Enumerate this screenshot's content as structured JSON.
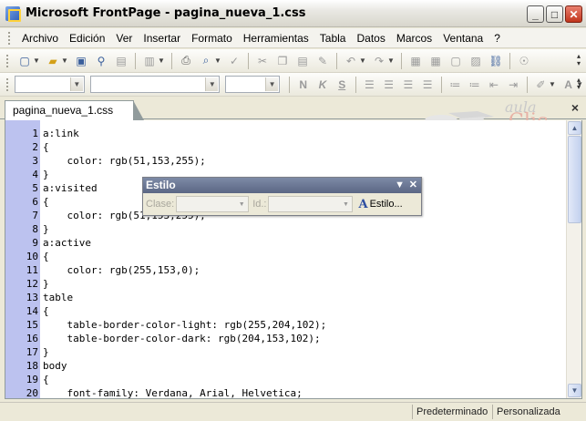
{
  "window": {
    "title": "Microsoft FrontPage - pagina_nueva_1.css",
    "buttons": {
      "minimize": "_",
      "maximize": "□",
      "close": "✕"
    }
  },
  "menu": {
    "items": [
      {
        "label": "Archivo"
      },
      {
        "label": "Edición"
      },
      {
        "label": "Ver"
      },
      {
        "label": "Insertar"
      },
      {
        "label": "Formato"
      },
      {
        "label": "Herramientas"
      },
      {
        "label": "Tabla"
      },
      {
        "label": "Datos"
      },
      {
        "label": "Marcos"
      },
      {
        "label": "Ventana"
      },
      {
        "label": "?"
      }
    ]
  },
  "toolbar_standard": {
    "icons": [
      "new-page-icon",
      "open-icon",
      "save-icon",
      "search-icon",
      "publish-icon",
      "toggle-pane-icon",
      "print-icon",
      "print-preview-icon",
      "spelling-icon",
      "cut-icon",
      "copy-icon",
      "paste-icon",
      "format-painter-icon",
      "undo-icon",
      "redo-icon",
      "web-component-icon",
      "insert-table-icon",
      "insert-layer-icon",
      "insert-picture-icon",
      "insert-hyperlink-icon",
      "help-icon"
    ]
  },
  "toolbar_format": {
    "style_value": "",
    "font_value": "",
    "size_value": "",
    "bold": "N",
    "italic": "K",
    "underline": "S"
  },
  "tab": {
    "label": "pagina_nueva_1.css",
    "close": "×"
  },
  "logo": {
    "top": "aula",
    "bottom": "Clic"
  },
  "editor": {
    "lines": [
      {
        "n": "1",
        "code": "a:link"
      },
      {
        "n": "2",
        "code": "{"
      },
      {
        "n": "3",
        "code": "    color: rgb(51,153,255);"
      },
      {
        "n": "4",
        "code": "}"
      },
      {
        "n": "5",
        "code": "a:visited"
      },
      {
        "n": "6",
        "code": "{"
      },
      {
        "n": "7",
        "code": "    color: rgb(51,153,255);"
      },
      {
        "n": "8",
        "code": "}"
      },
      {
        "n": "9",
        "code": "a:active"
      },
      {
        "n": "10",
        "code": "{"
      },
      {
        "n": "11",
        "code": "    color: rgb(255,153,0);"
      },
      {
        "n": "12",
        "code": "}"
      },
      {
        "n": "13",
        "code": "table"
      },
      {
        "n": "14",
        "code": "{"
      },
      {
        "n": "15",
        "code": "    table-border-color-light: rgb(255,204,102);"
      },
      {
        "n": "16",
        "code": "    table-border-color-dark: rgb(204,153,102);"
      },
      {
        "n": "17",
        "code": "}"
      },
      {
        "n": "18",
        "code": "body"
      },
      {
        "n": "19",
        "code": "{"
      },
      {
        "n": "20",
        "code": "    font-family: Verdana, Arial, Helvetica;"
      }
    ]
  },
  "estilo_toolbar": {
    "title": "Estilo",
    "clase_label": "Clase:",
    "id_label": "Id.:",
    "button_label": "Estilo..."
  },
  "status": {
    "mode": "Predeterminado",
    "view": "Personalizada"
  }
}
